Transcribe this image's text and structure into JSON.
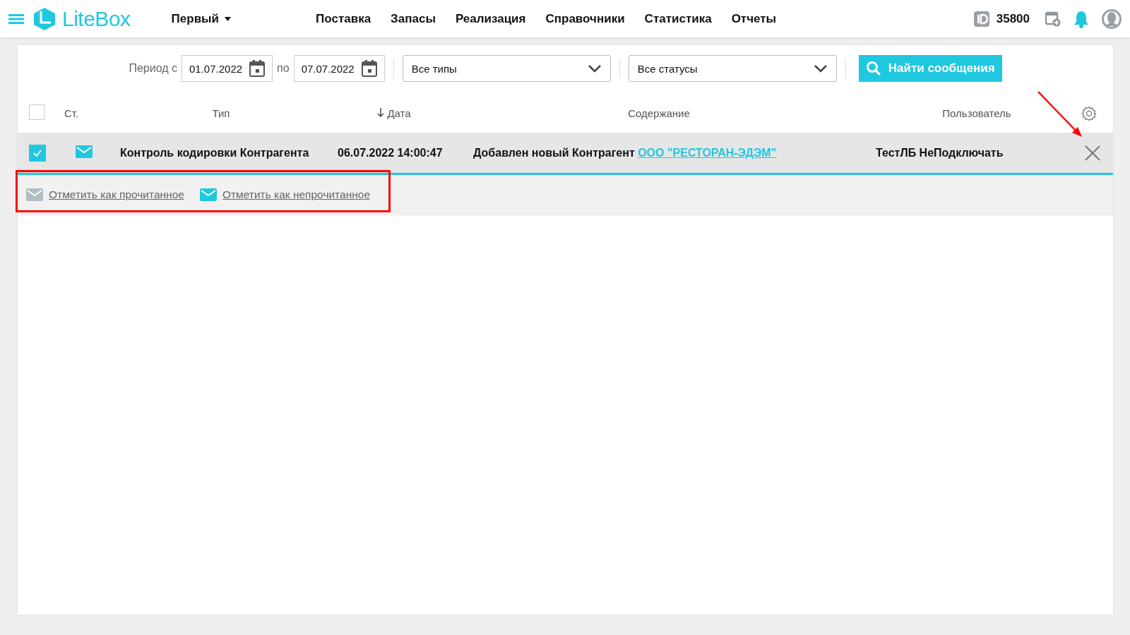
{
  "header": {
    "logo": "LiteBox",
    "organization": "Первый",
    "nav": [
      "Поставка",
      "Запасы",
      "Реализация",
      "Справочники",
      "Статистика",
      "Отчеты"
    ],
    "id": "35800"
  },
  "filters": {
    "period_label": "Период с",
    "date_from": "01.07.2022",
    "to_label": "по",
    "date_to": "07.07.2022",
    "type_select": "Все типы",
    "status_select": "Все статусы",
    "search_button": "Найти сообщения"
  },
  "table": {
    "select_all": {
      "checked": false
    },
    "columns": [
      {
        "label": "Ст.",
        "sorted": false
      },
      {
        "label": "Тип",
        "sorted": false
      },
      {
        "label": "Дата",
        "sorted": true
      },
      {
        "label": "Содержание",
        "sorted": false
      },
      {
        "label": "Пользователь",
        "sorted": false
      }
    ],
    "rows": [
      {
        "checked": true,
        "unread": true,
        "type": "Контроль кодировки Контрагента",
        "date": "06.07.2022 14:00:47",
        "content": "Добавлен новый Контрагент",
        "content_link": "ООО \"РЕСТОРАН-ЭДЭМ\"",
        "user": "ТестЛБ НеПодключать"
      }
    ],
    "actions": [
      {
        "label": "Отметить как прочитанное",
        "kind": "read"
      },
      {
        "label": "Отметить как непрочитанное",
        "kind": "unread"
      }
    ]
  }
}
